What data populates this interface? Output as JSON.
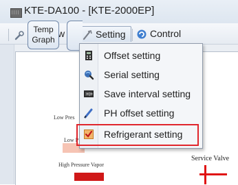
{
  "window": {
    "title": "KTE-DA100 - [KTE-2000EP]"
  },
  "menubar": {
    "view_label": "View",
    "setting_label": "Setting",
    "control_label": "Control"
  },
  "setting_menu": {
    "items": [
      {
        "label": "Offset setting",
        "icon": "offset-icon"
      },
      {
        "label": "Serial setting",
        "icon": "serial-icon"
      },
      {
        "label": "Save interval setting",
        "icon": "save-interval-icon"
      },
      {
        "label": "PH offset setting",
        "icon": "pencil-icon"
      },
      {
        "label": "Refrigerant setting",
        "icon": "checkbox-checked-icon"
      }
    ],
    "highlight_color": "#e0242b"
  },
  "diagram": {
    "temp_graph_line1": "Temp",
    "temp_graph_line2": "Graph",
    "low_pressure_1": "Low Pres",
    "low_pressure_2": "Low P",
    "high_pressure_vapor": "High Pressure Vapor",
    "service_valve": "Service Valve"
  }
}
